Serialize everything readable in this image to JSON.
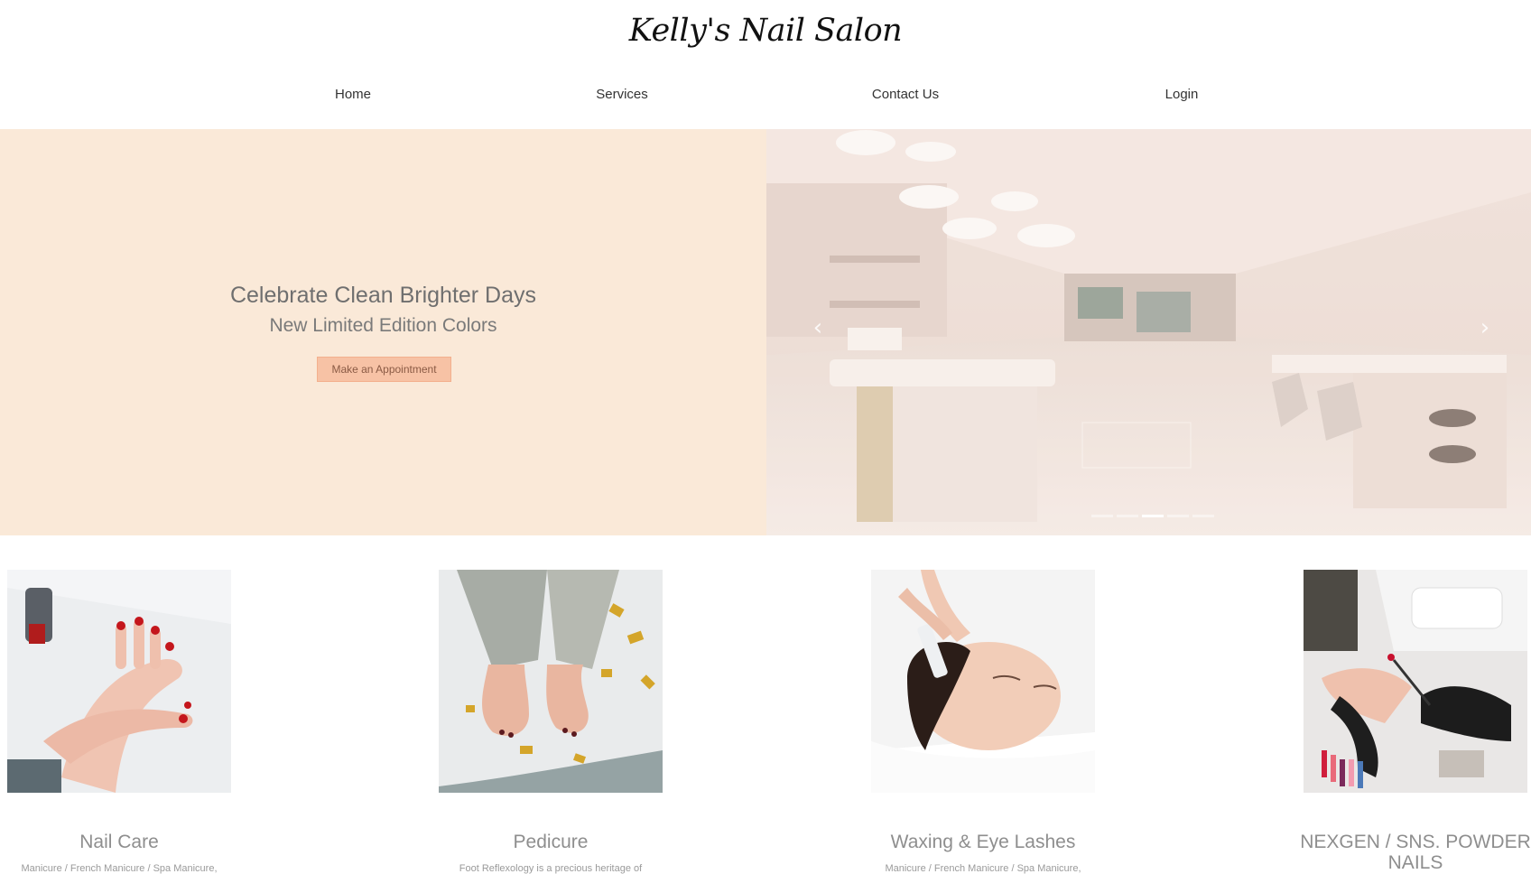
{
  "header": {
    "logo": "Kelly's Nail Salon"
  },
  "nav": {
    "items": [
      {
        "label": "Home"
      },
      {
        "label": "Services"
      },
      {
        "label": "Contact Us"
      },
      {
        "label": "Login"
      }
    ]
  },
  "hero": {
    "title": "Celebrate Clean Brighter Days",
    "subtitle": "New Limited Edition Colors",
    "cta_label": "Make an Appointment",
    "slide_image": "salon-interior-photo",
    "prev_icon": "chevron-left-icon",
    "next_icon": "chevron-right-icon",
    "indicator_count": 5,
    "active_indicator": 3
  },
  "services": [
    {
      "title": "Nail Care",
      "desc": "Manicure / French Manicure / Spa Manicure,",
      "image": "hands-with-red-nails-photo"
    },
    {
      "title": "Pedicure",
      "desc": "Foot Reflexology is a precious heritage of",
      "image": "bare-feet-with-confetti-photo"
    },
    {
      "title": "Waxing & Eye Lashes",
      "desc": "Manicure / French Manicure / Spa Manicure,",
      "image": "facial-waxing-photo"
    },
    {
      "title": "NEXGEN / SNS. POWDER NAILS",
      "desc": "",
      "image": "gloved-technician-painting-nails-photo"
    }
  ],
  "colors": {
    "hero_bg": "#fae9d8",
    "cta_bg": "#f7c2a5",
    "text_muted": "#8e8e8e"
  }
}
